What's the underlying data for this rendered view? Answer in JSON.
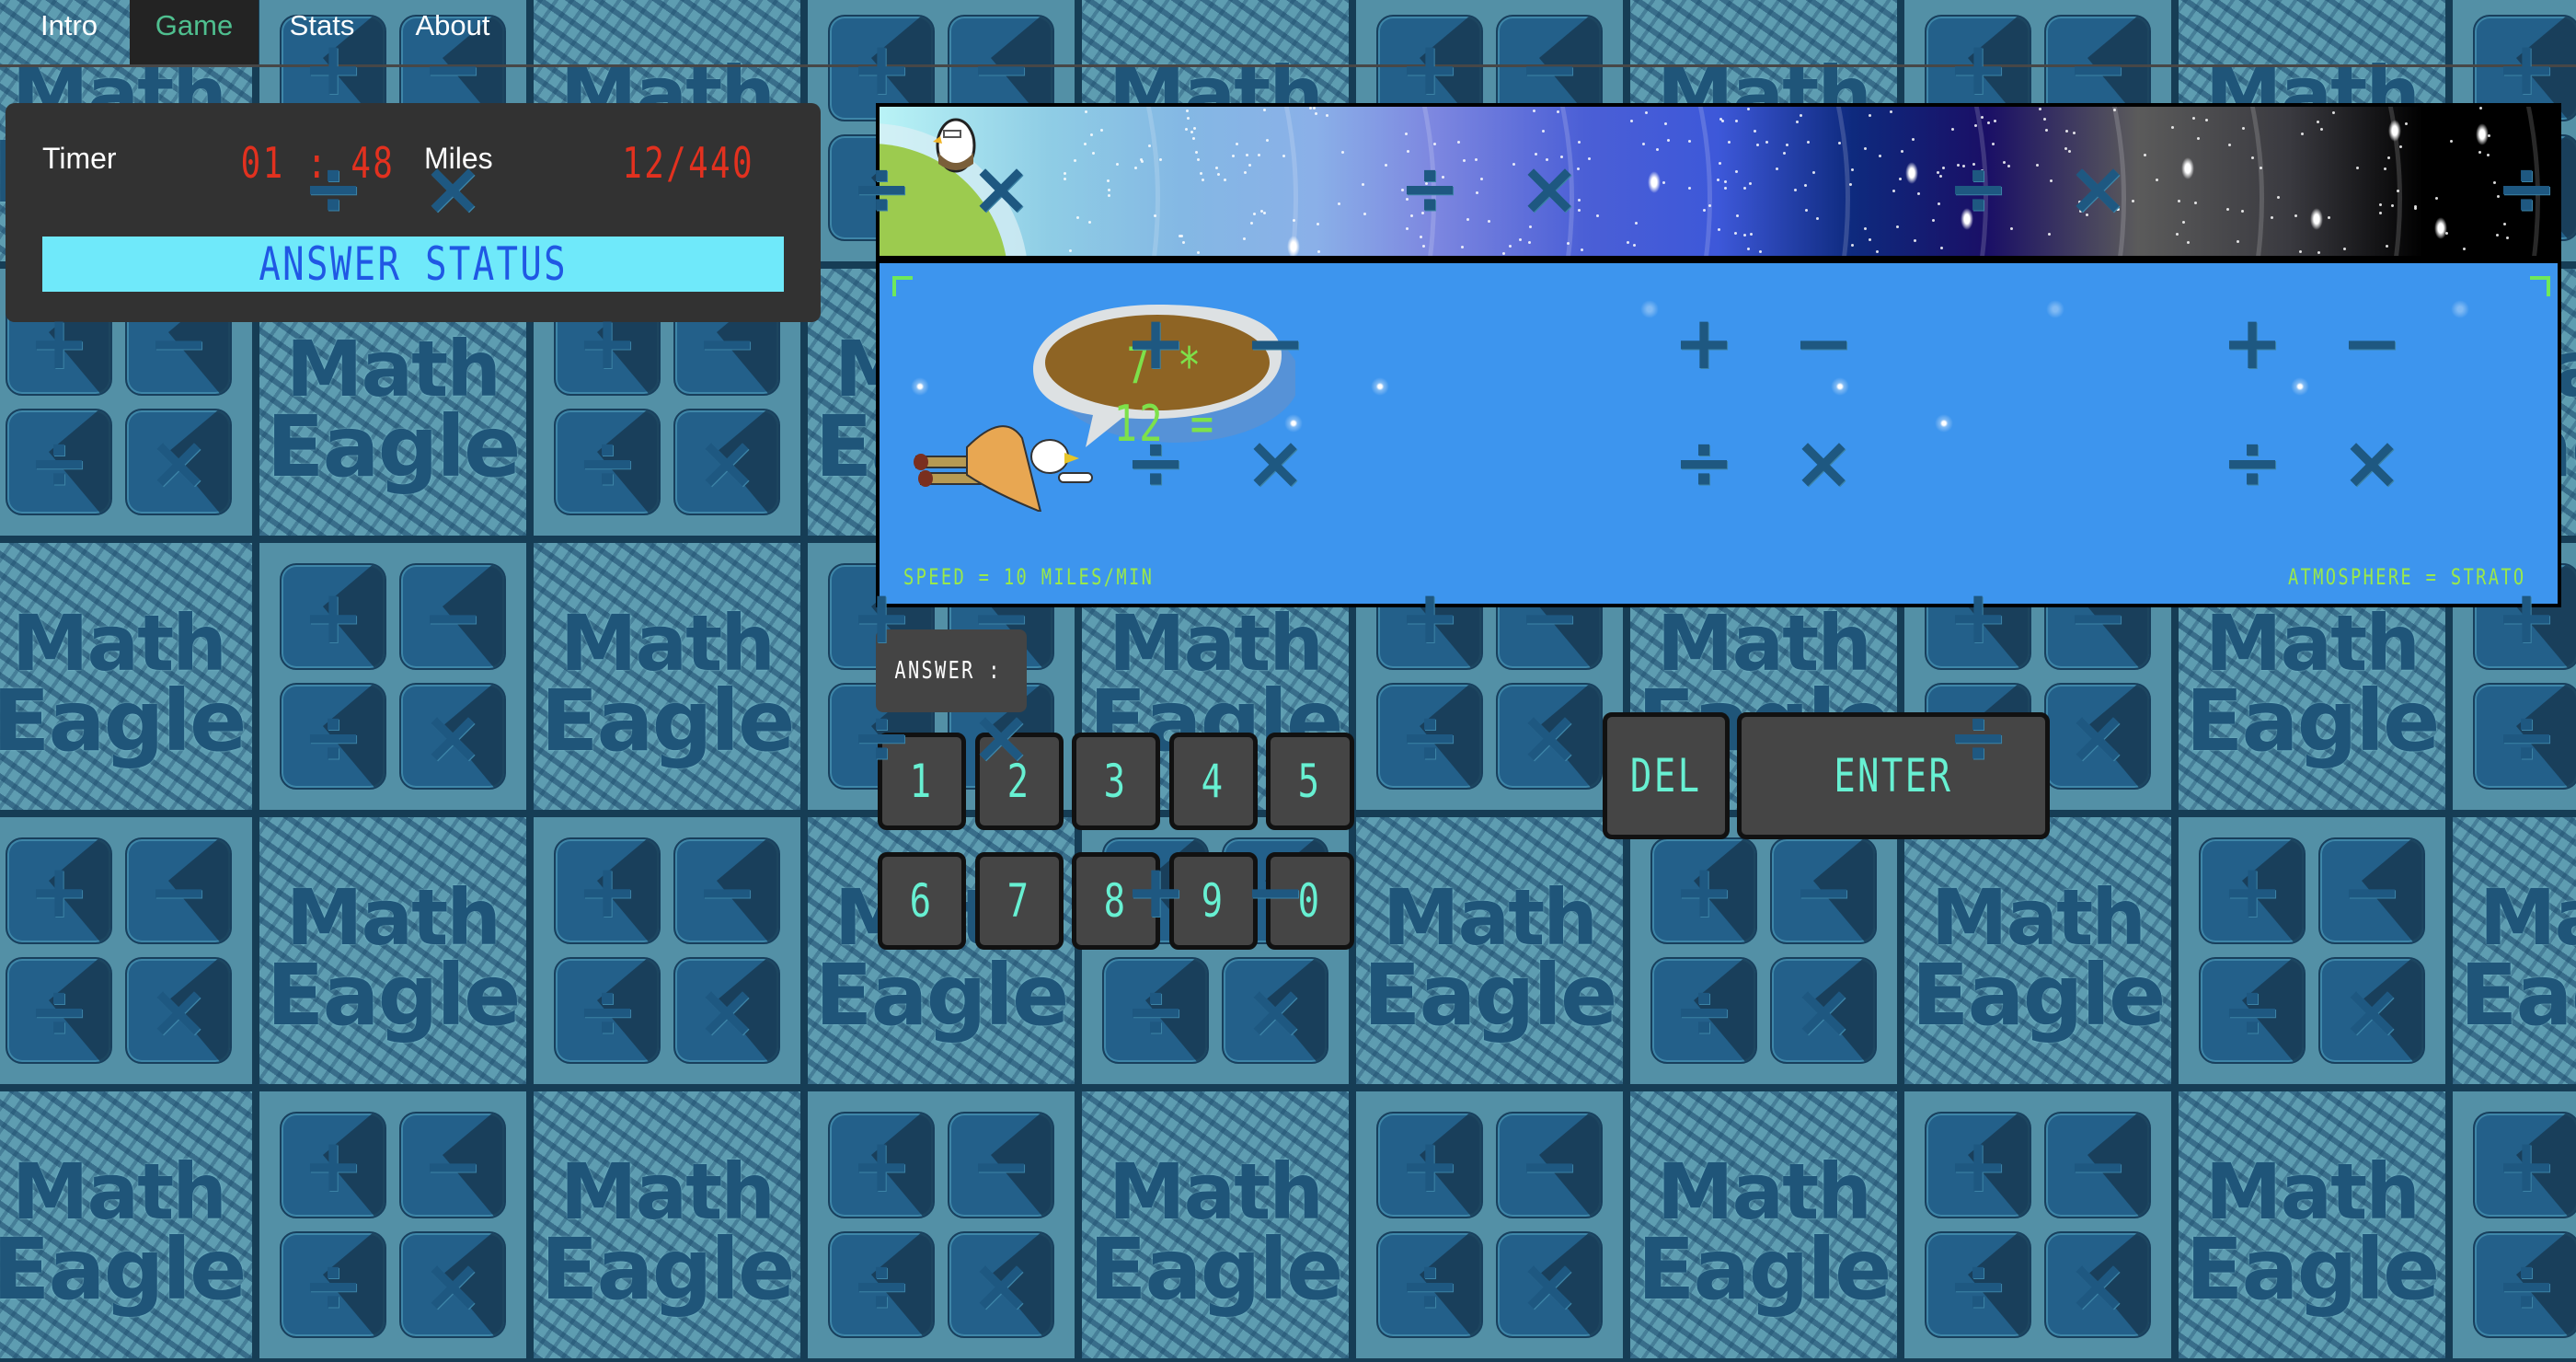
{
  "tabs": [
    {
      "label": "Intro",
      "active": false
    },
    {
      "label": "Game",
      "active": true
    },
    {
      "label": "Stats",
      "active": false
    },
    {
      "label": "About",
      "active": false
    }
  ],
  "stats": {
    "timer_label": "Timer",
    "timer_value": "01 : 48",
    "miles_label": "Miles",
    "miles_value": "12/440",
    "answer_status": "ANSWER STATUS"
  },
  "game": {
    "problem": "7 * 12 =",
    "speed_text": "SPEED = 10 MILES/MIN",
    "atmosphere_text": "ATMOSPHERE = STRATO",
    "progress_fraction": 0.027
  },
  "answer": {
    "label": "ANSWER :",
    "value": ""
  },
  "keypad": {
    "row1": [
      "1",
      "2",
      "3",
      "4",
      "5"
    ],
    "row2": [
      "6",
      "7",
      "8",
      "9",
      "0"
    ],
    "delete_label": "DEL",
    "enter_label": "ENTER"
  },
  "background": {
    "tile_words": [
      "Math",
      "Eagle"
    ],
    "tile_operators": [
      "+",
      "−",
      "÷",
      "×"
    ]
  },
  "colors": {
    "active_tab": "#4fbf8f",
    "lcd_red": "#e2311f",
    "status_bg": "#6fe9fa",
    "status_text": "#2058e4",
    "sky": "#3d95ee",
    "sky_text": "#9ae94a",
    "key_text": "#67f0d2"
  }
}
